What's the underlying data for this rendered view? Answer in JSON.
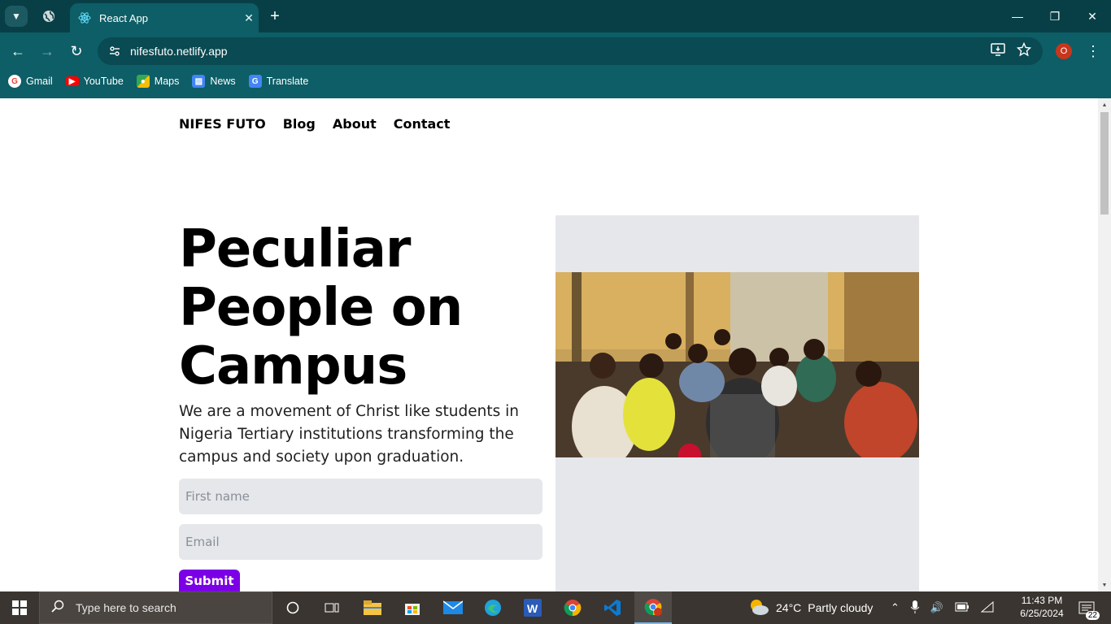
{
  "browser": {
    "tab": {
      "title": "React App",
      "close_icon": "close-icon"
    },
    "url": "nifesfuto.netlify.app",
    "profile_badge": "O",
    "bookmarks": [
      {
        "label": "Gmail",
        "icon": "gmail-icon",
        "color": "#ea4335"
      },
      {
        "label": "YouTube",
        "icon": "youtube-icon",
        "color": "#ff0000"
      },
      {
        "label": "Maps",
        "icon": "maps-icon",
        "color": "#34a853"
      },
      {
        "label": "News",
        "icon": "news-icon",
        "color": "#4285f4"
      },
      {
        "label": "Translate",
        "icon": "translate-icon",
        "color": "#4285f4"
      }
    ]
  },
  "site": {
    "nav": {
      "brand": "NIFES FUTO",
      "blog": "Blog",
      "about": "About",
      "contact": "Contact"
    },
    "hero": {
      "title": "Peculiar People on Campus",
      "subtitle": "We are a movement of Christ like students in Nigeria Tertiary institutions transforming the campus and society upon graduation."
    },
    "form": {
      "first_name_placeholder": "First name",
      "email_placeholder": "Email",
      "submit_label": "Submit"
    },
    "colors": {
      "accent": "#7c00e6",
      "field_bg": "#e5e7eb",
      "chrome": "#0d5e66"
    }
  },
  "taskbar": {
    "search_placeholder": "Type here to search",
    "weather": {
      "temp": "24°C",
      "condition": "Partly cloudy"
    },
    "clock": {
      "time": "11:43 PM",
      "date": "6/25/2024"
    },
    "notifications": "22"
  }
}
